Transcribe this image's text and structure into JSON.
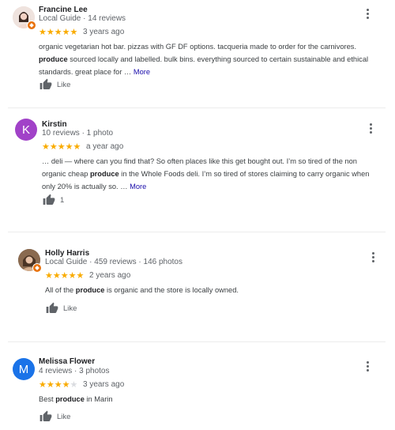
{
  "reviews": [
    {
      "name": "Francine Lee",
      "meta": "Local Guide · 14 reviews",
      "rating": 5,
      "time": "3 years ago",
      "text_parts": [
        "organic vegetarian hot bar. pizzas with GF DF options. tacqueria made to order for the carnivores. ",
        "produce",
        " sourced locally and labelled. bulk bins. everything sourced to certain sustainable and ethical standards. great place for … "
      ],
      "more": "More",
      "like_label": "Like",
      "avatar_color": "#e8d6cf"
    },
    {
      "name": "Kirstin",
      "meta": "10 reviews · 1 photo",
      "rating": 5,
      "time": "a year ago",
      "text_parts": [
        "… deli — where can you find that? So often places like this get bought out. I’m so tired of the non organic cheap ",
        "produce",
        " in the Whole Foods deli. I’m so tired of stores claiming to carry organic when only 20% is actually so. … "
      ],
      "more": "More",
      "like_label": "1",
      "avatar_letter": "K",
      "avatar_color": "#a142c8"
    },
    {
      "name": "Holly Harris",
      "meta": "Local Guide · 459 reviews · 146 photos",
      "rating": 5,
      "time": "2 years ago",
      "text_parts": [
        "All of the ",
        "produce",
        " is organic and the store is locally owned."
      ],
      "like_label": "Like",
      "avatar_color": "#6b4f3a"
    },
    {
      "name": "Melissa Flower",
      "meta": "4 reviews · 3 photos",
      "rating": 4,
      "time": "3 years ago",
      "text_parts": [
        "Best ",
        "produce",
        " in Marin"
      ],
      "like_label": "Like",
      "avatar_letter": "M",
      "avatar_color": "#1a73e8"
    }
  ],
  "icons": {
    "like": "thumbs-up-icon",
    "menu": "more-vert-icon",
    "guide": "local-guide-badge-icon"
  },
  "colors": {
    "star": "#f9ab00",
    "link": "#1a0dab",
    "muted": "#5f6368"
  }
}
